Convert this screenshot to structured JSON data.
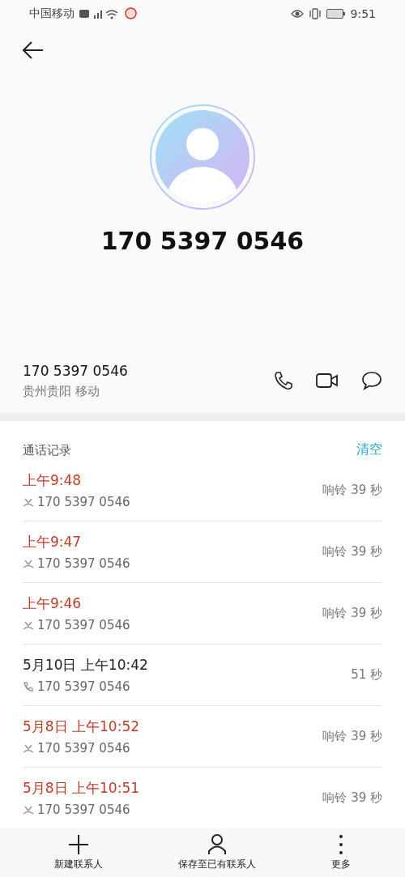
{
  "status_bar": {
    "carrier": "中国移动",
    "time": "9:51"
  },
  "contact": {
    "title": "170 5397 0546",
    "number": "170 5397 0546",
    "location": "贵州贵阳 移动"
  },
  "call_log": {
    "title": "通话记录",
    "clear": "清空",
    "rows": [
      {
        "kind": "missed",
        "time": "上午9:48",
        "number": "170 5397 0546",
        "duration": "响铃 39 秒"
      },
      {
        "kind": "missed",
        "time": "上午9:47",
        "number": "170 5397 0546",
        "duration": "响铃 39 秒"
      },
      {
        "kind": "missed",
        "time": "上午9:46",
        "number": "170 5397 0546",
        "duration": "响铃 39 秒"
      },
      {
        "kind": "answered",
        "time": "5月10日 上午10:42",
        "number": "170 5397 0546",
        "duration": "51 秒"
      },
      {
        "kind": "missed",
        "time": "5月8日 上午10:52",
        "number": "170 5397 0546",
        "duration": "响铃 39 秒"
      },
      {
        "kind": "missed",
        "time": "5月8日 上午10:51",
        "number": "170 5397 0546",
        "duration": "响铃 39 秒"
      }
    ]
  },
  "bottom_bar": [
    {
      "kind": "add",
      "label": "新建联系人"
    },
    {
      "kind": "person",
      "label": "保存至已有联系人"
    },
    {
      "kind": "more",
      "label": "更多"
    }
  ]
}
